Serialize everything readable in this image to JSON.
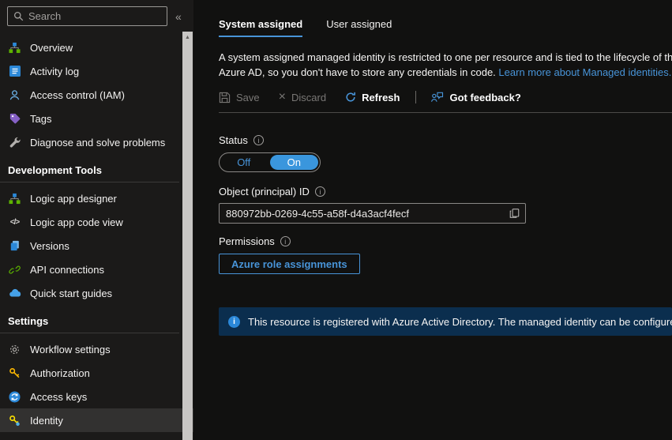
{
  "colors": {
    "accent_blue": "#4894d8",
    "toggle_on_blue": "#3a96dd",
    "banner_bg": "#0b2e4e",
    "sidebar_bg": "#1b1a19",
    "main_bg": "#111110",
    "selected_row_bg": "#323130",
    "disabled_gray": "#797775"
  },
  "sidebar": {
    "search": {
      "placeholder": "Search"
    },
    "collapse_glyph": "«",
    "scroll_up_glyph": "▲",
    "sections": [
      {
        "header": "",
        "items": [
          {
            "label": "Overview",
            "icon": "overview-icon"
          },
          {
            "label": "Activity log",
            "icon": "activity-log-icon"
          },
          {
            "label": "Access control (IAM)",
            "icon": "access-control-icon"
          },
          {
            "label": "Tags",
            "icon": "tag-icon"
          },
          {
            "label": "Diagnose and solve problems",
            "icon": "wrench-icon"
          }
        ]
      },
      {
        "header": "Development Tools",
        "items": [
          {
            "label": "Logic app designer",
            "icon": "designer-icon"
          },
          {
            "label": "Logic app code view",
            "icon": "code-icon"
          },
          {
            "label": "Versions",
            "icon": "versions-icon"
          },
          {
            "label": "API connections",
            "icon": "api-connections-icon"
          },
          {
            "label": "Quick start guides",
            "icon": "cloud-icon"
          }
        ]
      },
      {
        "header": "Settings",
        "items": [
          {
            "label": "Workflow settings",
            "icon": "gear-icon"
          },
          {
            "label": "Authorization",
            "icon": "key-icon"
          },
          {
            "label": "Access keys",
            "icon": "access-keys-icon"
          },
          {
            "label": "Identity",
            "icon": "identity-key-icon",
            "selected": true
          }
        ]
      }
    ]
  },
  "main": {
    "tabs": [
      {
        "label": "System assigned",
        "active": true
      },
      {
        "label": "User assigned",
        "active": false
      }
    ],
    "description": {
      "line1": "A system assigned managed identity is restricted to one per resource and is tied to the lifecycle of this resource. You can grant permissions to the managed identity by using Azure",
      "line2": "Azure AD, so you don't have to store any credentials in code. ",
      "link": "Learn more about Managed identities."
    },
    "toolbar": {
      "save": "Save",
      "discard": "Discard",
      "refresh": "Refresh",
      "feedback": "Got feedback?"
    },
    "status": {
      "label": "Status",
      "off_label": "Off",
      "on_label": "On",
      "value": "On"
    },
    "object_id": {
      "label": "Object (principal) ID",
      "value": "880972bb-0269-4c55-a58f-d4a3acf4fecf"
    },
    "permissions": {
      "label": "Permissions",
      "button": "Azure role assignments"
    },
    "banner": {
      "text": "This resource is registered with Azure Active Directory. The managed identity can be configured to allow access"
    },
    "info_glyph": "i"
  }
}
